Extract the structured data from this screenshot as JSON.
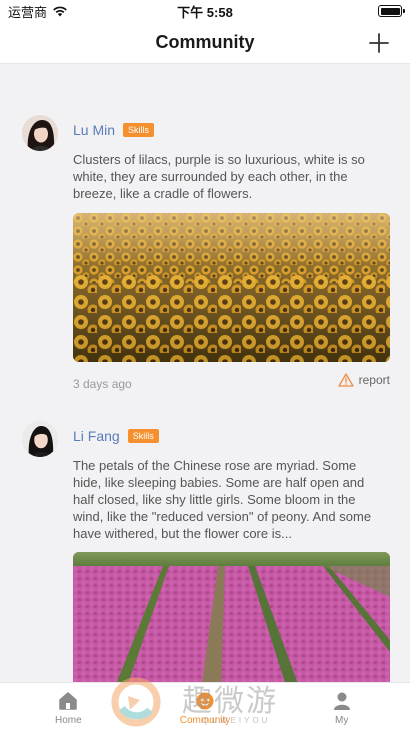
{
  "status_bar": {
    "carrier": "运营商",
    "time": "下午 5:58",
    "battery_level": 1.0
  },
  "nav": {
    "title": "Community",
    "add_icon": "plus-icon"
  },
  "posts": [
    {
      "author": "Lu Min",
      "badge": "Skills",
      "text": "Clusters of lilacs, purple is so luxurious, white is so white, they are surrounded by each other, in the breeze, like a cradle of flowers.",
      "image": "sunflower-field-photo",
      "time": "3 days ago",
      "report_label": "report"
    },
    {
      "author": "Li Fang",
      "badge": "Skills",
      "text": "The petals of the Chinese rose are myriad. Some hide, like sleeping babies. Some are half open and half closed, like shy little girls. Some bloom in the wind, like the \"reduced version\" of peony. And some have withered, but the flower core is...",
      "image": "tulip-field-photo"
    }
  ],
  "tabs": [
    {
      "label": "Home",
      "icon": "home-icon",
      "active": false
    },
    {
      "label": "Community",
      "icon": "community-icon",
      "active": true
    },
    {
      "label": "My",
      "icon": "person-icon",
      "active": false
    }
  ],
  "watermark": {
    "text": "趣微游",
    "subtext": "QUWEIYOU"
  },
  "colors": {
    "accent": "#f5902f",
    "author_name": "#5a7cb8",
    "background": "#f2f2f5"
  }
}
